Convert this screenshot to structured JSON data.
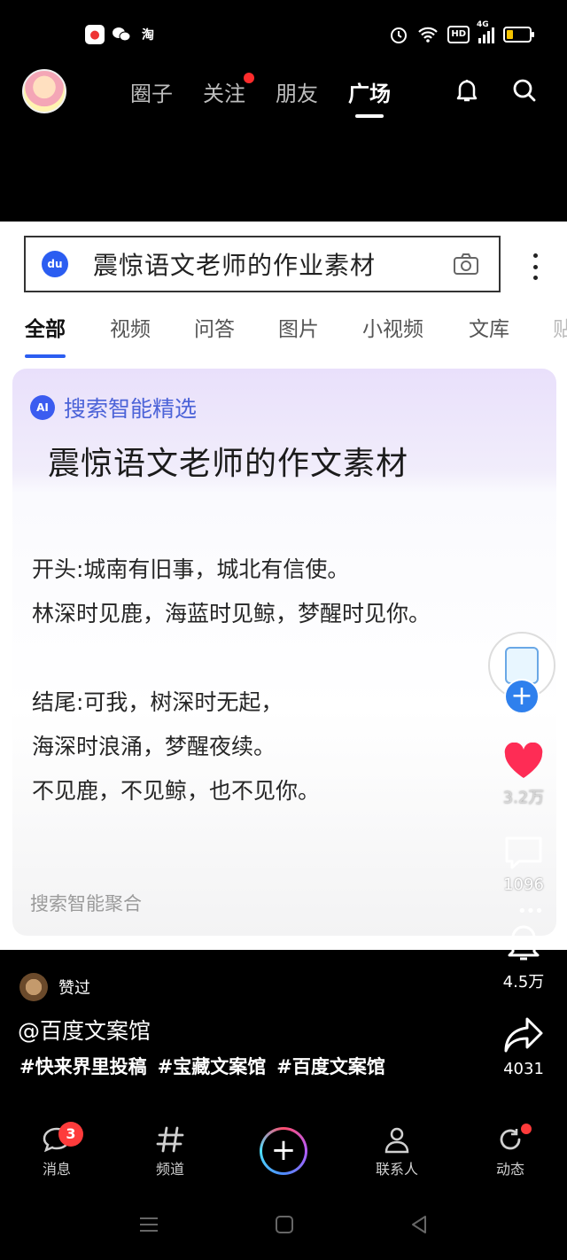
{
  "status_bar": {
    "apps": [
      "red-app-icon",
      "wechat-icon",
      "taobao-icon"
    ],
    "taobao_glyph": "淘",
    "hd_label": "HD",
    "network_label": "4G",
    "battery_level": 0.3
  },
  "top_nav": {
    "tabs": [
      {
        "label": "圈子"
      },
      {
        "label": "关注"
      },
      {
        "label": "朋友"
      },
      {
        "label": "广场"
      }
    ],
    "active_tab": "广场"
  },
  "content": {
    "search_query": "震惊语文老师的作业素材",
    "search_logo": "du",
    "sub_tabs": [
      "全部",
      "视频",
      "问答",
      "图片",
      "小视频",
      "文库",
      "贴"
    ],
    "ai_logo": "AI",
    "ai_label": "搜索智能精选",
    "ai_title": "震惊语文老师的作文素材",
    "lines_a": [
      "开头:城南有旧事，城北有信使。",
      "林深时见鹿，海蓝时见鲸，梦醒时见你。"
    ],
    "lines_b": [
      "结尾:可我，树深时无起，",
      "海深时浪涌，梦醒夜续。",
      "不见鹿，不见鲸，也不见你。"
    ],
    "footer": "搜索智能聚合"
  },
  "actions": {
    "follow_symbol": "+",
    "likes": "3.2万",
    "comments": "1096",
    "collects": "4.5万",
    "shares": "4031"
  },
  "caption": {
    "liker_text": "赞过",
    "author": "@百度文案馆",
    "tags": [
      "#快来界里投稿",
      "#宝藏文案馆",
      "#百度文案馆"
    ]
  },
  "bottom_nav": {
    "messages": "消息",
    "messages_badge": "3",
    "channels": "频道",
    "create_symbol": "+",
    "contacts": "联系人",
    "updates": "动态"
  }
}
